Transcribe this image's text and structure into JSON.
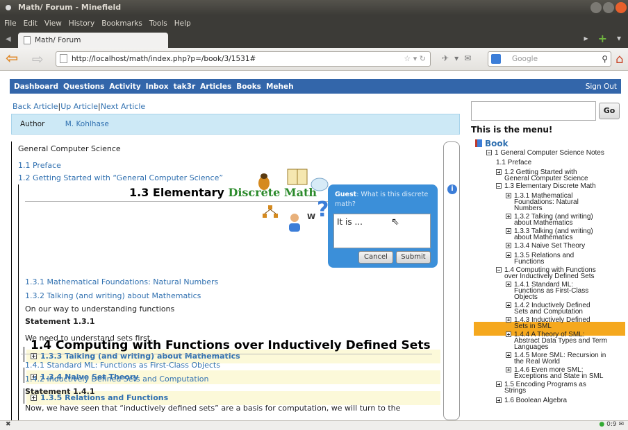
{
  "window": {
    "title": "Math/ Forum - Minefield"
  },
  "menubar": [
    "File",
    "Edit",
    "View",
    "History",
    "Bookmarks",
    "Tools",
    "Help"
  ],
  "tab": {
    "label": "Math/ Forum"
  },
  "address": {
    "url": "http://localhost/math/index.php?p=/book/3/1531#"
  },
  "search": {
    "placeholder": "Google"
  },
  "topnav": {
    "items": [
      "Dashboard",
      "Questions",
      "Activity",
      "Inbox",
      "tak3r",
      "Articles",
      "Books",
      "Meheh"
    ],
    "signout": "Sign Out"
  },
  "article_nav": {
    "back": "Back Article",
    "up": "Up Article",
    "next": "Next Article",
    "sep": "|"
  },
  "author": {
    "label": "Author",
    "name": "M. Kohlhase"
  },
  "doc": {
    "top_title": "General Computer Science",
    "preface": "1.1 Preface",
    "getting_started": "1.2 Getting Started with “General Computer Science”",
    "sec13_title": "1.3 Elementary",
    "sec13_highlight": "Discrete Math",
    "s131": "1.3.1 Mathematical Foundations: Natural Numbers",
    "s132": "1.3.2 Talking (and writing) about Mathematics",
    "on_our_way": "On our way to understanding functions",
    "statement1": "Statement 1.3.1",
    "sets_first": "We need to understand sets first.",
    "c133": "1.3.3 Talking (and writing) about Mathematics",
    "c134": "1.3.4 Naive Set Theory",
    "c135": "1.3.5 Relations and Functions",
    "sec14_title": "1.4 Computing with Functions over Inductively Defined Sets",
    "s141": "1.4.1 Standard ML: Functions as First-Class Objects",
    "s142": "1.4.2 Inductively Defined Sets and Computation",
    "statement2": "Statement 1.4.1",
    "now_text": "Now, we have seen that “inductively defined sets” are a basis for computation, we will turn to the"
  },
  "popup": {
    "guest": "Guest",
    "question": ": What is this discrete math?",
    "answer": "It is ...",
    "cancel": "Cancel",
    "submit": "Submit"
  },
  "sidebar": {
    "go": "Go",
    "menu_title": "This is the menu!",
    "book": "Book",
    "tree": [
      "1 General Computer Science Notes",
      "1.1 Preface",
      "1.2 Getting Started with",
      "General Computer Science",
      "1.3 Elementary Discrete Math",
      "1.3.1 Mathematical",
      "Foundations: Natural",
      "Numbers",
      "1.3.2 Talking (and writing)",
      "about Mathematics",
      "1.3.3 Talking (and writing)",
      "about Mathematics",
      "1.3.4 Naive Set Theory",
      "1.3.5 Relations and",
      "Functions",
      "1.4 Computing with Functions",
      "over Inductively Defined Sets",
      "1.4.1 Standard ML:",
      "Functions as First-Class",
      "Objects",
      "1.4.2 Inductively Defined",
      "Sets and Computation",
      "1.4.3 Inductively Defined",
      "Sets in SML",
      "1.4.4 A Theory of SML:",
      "Abstract Data Types and Term",
      "Languages",
      "1.4.5 More SML: Recursion in",
      "the Real World",
      "1.4.6 Even more SML:",
      "Exceptions and State in SML",
      "1.5 Encoding Programs as",
      "Strings",
      "1.6 Boolean Algebra"
    ]
  },
  "status": {
    "time": "0:9"
  },
  "colors": {
    "nav_blue": "#3366aa",
    "link": "#3070b0",
    "highlight": "#f5a81e",
    "popup": "#3b8fd9"
  }
}
